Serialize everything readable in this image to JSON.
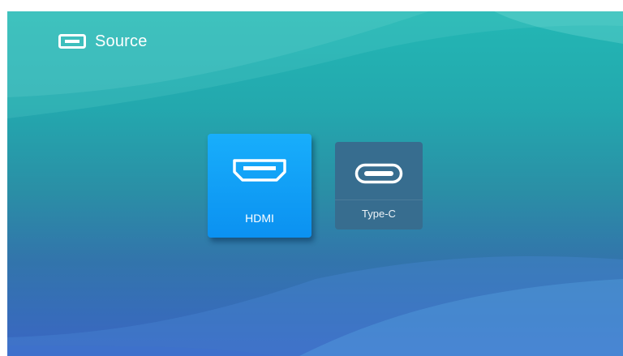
{
  "header": {
    "icon": "input-source-icon",
    "title": "Source"
  },
  "sources": [
    {
      "label": "HDMI",
      "icon": "hdmi-port-icon",
      "selected": true
    },
    {
      "label": "Type-C",
      "icon": "usb-type-c-port-icon",
      "selected": false
    }
  ],
  "colors": {
    "background_top": "#23b7b4",
    "background_bottom": "#3a66c4",
    "selected_tile": "#12a2f7",
    "normal_tile": "#376d8f",
    "text": "#ffffff"
  }
}
